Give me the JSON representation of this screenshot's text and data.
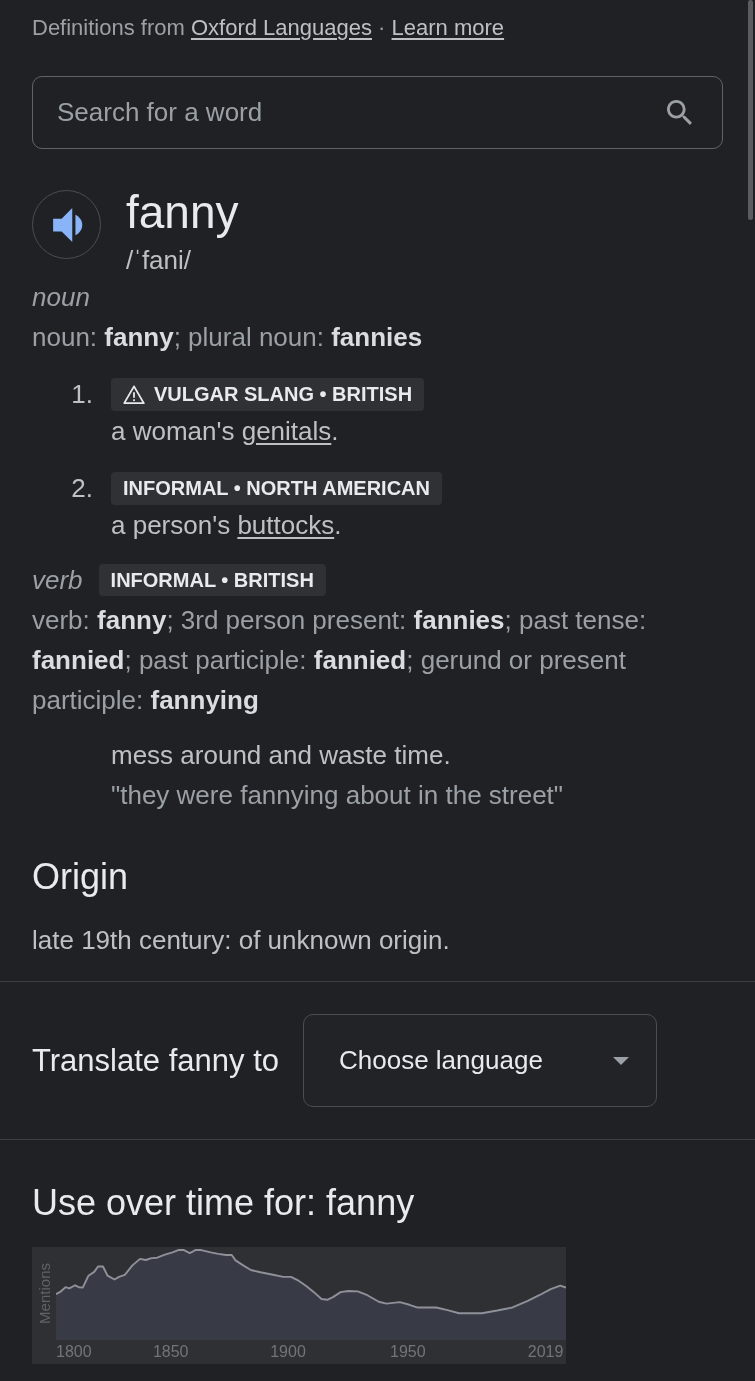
{
  "source": {
    "prefix": "Definitions from",
    "link": "Oxford Languages",
    "separator": "·",
    "more_link": "Learn more"
  },
  "search": {
    "placeholder": "Search for a word"
  },
  "headword": {
    "word": "fanny",
    "pronunciation": "/ˈfani/"
  },
  "entries": [
    {
      "part_of_speech": "noun",
      "forms": "noun: **fanny**; plural noun: **fannies**",
      "senses": [
        {
          "number": "1.",
          "labels": [
            {
              "text": "VULGAR SLANG • BRITISH",
              "warning": true
            }
          ],
          "definition": {
            "text": "a woman's ",
            "link": "genitals",
            "after": "."
          }
        },
        {
          "number": "2.",
          "labels": [
            {
              "text": "INFORMAL • NORTH AMERICAN",
              "warning": false
            }
          ],
          "definition": {
            "text": "a person's ",
            "link": "buttocks",
            "after": "."
          }
        }
      ]
    },
    {
      "part_of_speech": "verb",
      "labels": [
        {
          "text": "INFORMAL • BRITISH",
          "warning": false
        }
      ],
      "forms": "verb: **fanny**; 3rd person present: **fannies**; past tense: **fannied**; past participle: **fannied**; gerund or present participle: **fannying**",
      "senses": [
        {
          "definition": {
            "text": "mess around and waste time."
          },
          "example": "\"they were fannying about in the street\""
        }
      ]
    }
  ],
  "origin": {
    "heading": "Origin",
    "text": "late 19th century: of unknown origin."
  },
  "translate": {
    "label": "Translate fanny to",
    "dropdown": {
      "placeholder": "Choose language"
    }
  },
  "usage": {
    "heading": "Use over time for: fanny",
    "axis_label": "Mentions",
    "years": [
      "1800",
      "1850",
      "1900",
      "1950",
      "2019"
    ]
  }
}
